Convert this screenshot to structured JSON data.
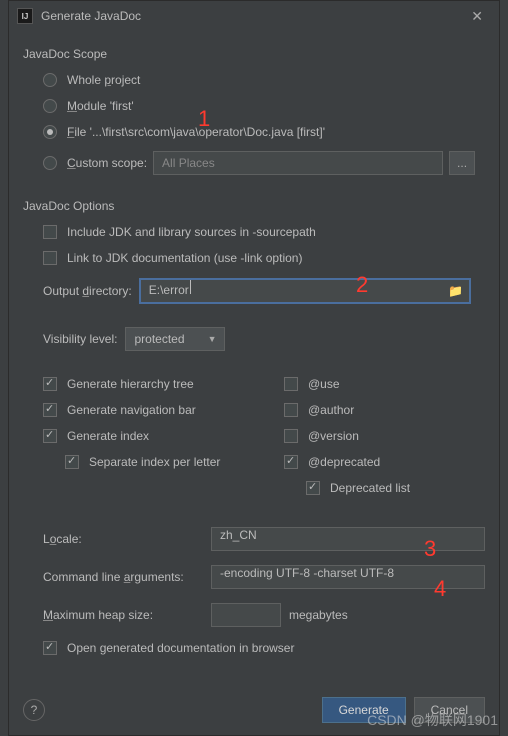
{
  "title": "Generate JavaDoc",
  "scope": {
    "label": "JavaDoc Scope",
    "whole_project": "Whole project",
    "module": "Module 'first'",
    "file": "File '...\\first\\src\\com\\java\\operator\\Doc.java [first]'",
    "custom": "Custom scope:",
    "custom_placeholder": "All Places",
    "browse": "..."
  },
  "options": {
    "label": "JavaDoc Options",
    "include_jdk": "Include JDK and library sources in -sourcepath",
    "link_jdk": "Link to JDK documentation (use -link option)",
    "output_dir_label": "Output directory:",
    "output_dir_value": "E:\\error",
    "visibility_label": "Visibility level:",
    "visibility_value": "protected",
    "gen_hierarchy": "Generate hierarchy tree",
    "gen_nav": "Generate navigation bar",
    "gen_index": "Generate index",
    "sep_index": "Separate index per letter",
    "use": "@use",
    "author": "@author",
    "version": "@version",
    "deprecated": "@deprecated",
    "deprecated_list": "Deprecated list",
    "locale_label": "Locale:",
    "locale_value": "zh_CN",
    "cmd_args_label": "Command line arguments:",
    "cmd_args_value": "-encoding UTF-8 -charset UTF-8",
    "heap_label": "Maximum heap size:",
    "heap_value": "",
    "heap_unit": "megabytes",
    "open_browser": "Open generated documentation in browser"
  },
  "buttons": {
    "generate": "Generate",
    "cancel": "Cancel"
  },
  "annotations": {
    "a1": "1",
    "a2": "2",
    "a3": "3",
    "a4": "4"
  },
  "watermark": "CSDN @物联网1901"
}
